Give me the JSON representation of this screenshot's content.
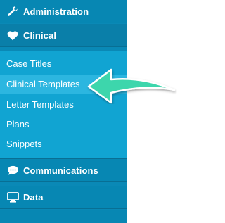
{
  "sidebar": {
    "sections": {
      "administration": {
        "label": "Administration",
        "icon": "wrench-icon"
      },
      "clinical": {
        "label": "Clinical",
        "icon": "heart-icon"
      },
      "communications": {
        "label": "Communications",
        "icon": "chat-bubble-icon"
      },
      "data": {
        "label": "Data",
        "icon": "monitor-icon"
      }
    },
    "clinical_items": [
      {
        "label": "Case Titles"
      },
      {
        "label": "Clinical Templates",
        "active": true
      },
      {
        "label": "Letter Templates"
      },
      {
        "label": "Plans"
      },
      {
        "label": "Snippets"
      }
    ]
  },
  "colors": {
    "sidebar_bg": "#0787b3",
    "subnav_bg": "#11a4d2",
    "active_item_bg": "#2cb6e0",
    "arrow": "#3dd6ac"
  }
}
